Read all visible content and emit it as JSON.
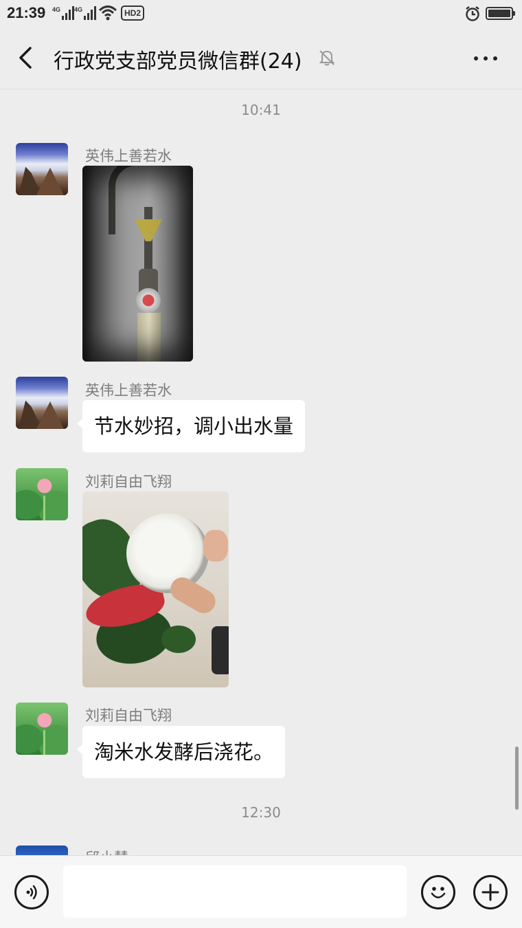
{
  "status_bar": {
    "time": "21:39",
    "signal_1": "4G",
    "signal_2": "4G",
    "wifi_icon": "wifi-icon",
    "hd_badge": "HD2",
    "alarm_icon": "alarm-icon",
    "battery_icon": "battery-icon"
  },
  "nav": {
    "back_icon": "chevron-left-icon",
    "title": "行政党支部党员微信群(24)",
    "mute_icon": "bell-off-icon",
    "more_icon": "more-dots-icon"
  },
  "chat": {
    "timestamps": [
      "10:41",
      "12:30"
    ],
    "messages": [
      {
        "sender": "英伟上善若水",
        "type": "image",
        "avatar": "mountain-avatar",
        "image_desc": "pipe-valve-photo"
      },
      {
        "sender": "英伟上善若水",
        "type": "text",
        "avatar": "mountain-avatar",
        "text": "节水妙招，调小出水量"
      },
      {
        "sender": "刘莉自由飞翔",
        "type": "image",
        "avatar": "lotus-avatar",
        "image_desc": "rice-water-plant-photo"
      },
      {
        "sender": "刘莉自由飞翔",
        "type": "text",
        "avatar": "lotus-avatar",
        "text": "淘米水发酵后浇花。"
      },
      {
        "sender": "邱小慧",
        "type": "partial",
        "avatar": "blue-avatar"
      }
    ]
  },
  "input_bar": {
    "voice_icon": "voice-icon",
    "input_value": "",
    "emoji_icon": "emoji-icon",
    "plus_icon": "plus-icon"
  }
}
